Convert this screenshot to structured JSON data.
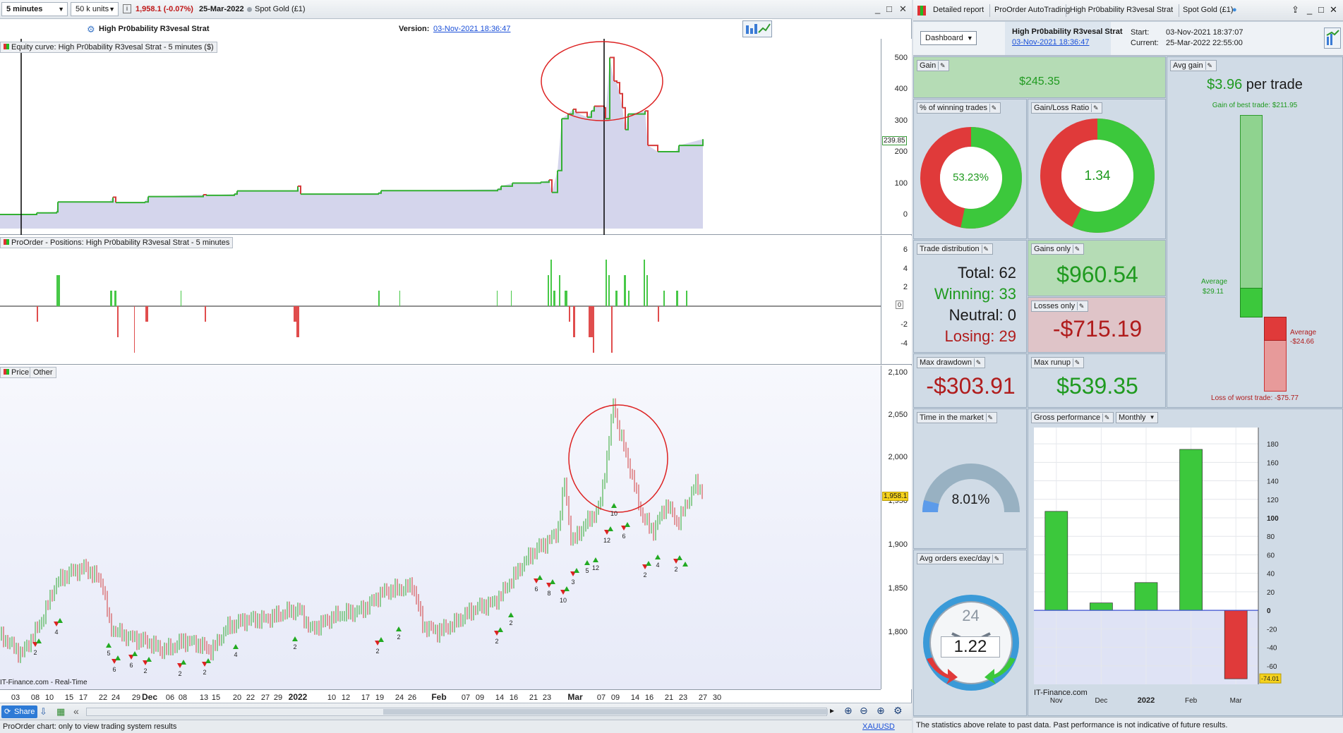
{
  "left": {
    "toolbar": {
      "timeframe": "5 minutes",
      "units": "50 k units",
      "price": "1,958.1 (-0.07%)",
      "date": "25-Mar-2022",
      "instrument": "Spot Gold (£1)"
    },
    "strategy_title": "High Pr0bability R3vesal Strat",
    "version_label": "Version:",
    "version_date": "03-Nov-2021 18:36:47",
    "panels": {
      "equity_label": "Equity curve: High Pr0bability R3vesal Strat - 5 minutes ($)",
      "positions_label": "ProOrder - Positions: High Pr0bability R3vesal Strat - 5 minutes",
      "price_label": "Price",
      "other_label": "Other"
    },
    "equity_axis": [
      "500",
      "400",
      "300",
      "200",
      "100",
      "0"
    ],
    "equity_last": "239.85",
    "positions_axis": [
      "6",
      "4",
      "2",
      "0",
      "-2",
      "-4"
    ],
    "positions_last": "0",
    "price_axis": [
      "2,100",
      "2,050",
      "2,000",
      "1,950",
      "1,900",
      "1,850",
      "1,800"
    ],
    "price_last": "1,958.1",
    "watermark": "IT-Finance.com - Real-Time",
    "date_axis": [
      "03",
      "08",
      "10",
      "15",
      "17",
      "22",
      "24",
      "29",
      "Dec",
      "06",
      "08",
      "13",
      "15",
      "20",
      "22",
      "27",
      "29",
      "2022",
      "10",
      "12",
      "17",
      "19",
      "24",
      "26",
      "Feb",
      "07",
      "09",
      "14",
      "16",
      "21",
      "23",
      "Mar",
      "07",
      "09",
      "14",
      "16",
      "21",
      "23",
      "27",
      "30"
    ],
    "trade_labels": [
      "2",
      "4",
      "5",
      "6",
      "6",
      "2",
      "2",
      "2",
      "4",
      "2",
      "2",
      "2",
      "2",
      "2",
      "6",
      "8",
      "10",
      "3",
      "5",
      "12",
      "12",
      "10",
      "6",
      "2",
      "4",
      "2"
    ],
    "share_label": "Share",
    "status_text": "ProOrder chart: only to view trading system results",
    "status_right": "XAUUSD"
  },
  "right": {
    "tabs": [
      "Detailed report",
      "ProOrder AutoTrading",
      "High Pr0bability R3vesal Strat",
      "Spot Gold (£1)"
    ],
    "dashboard_label": "Dashboard",
    "strategy_title": "High Pr0bability R3vesal Strat",
    "strategy_date": "03-Nov-2021 18:36:47",
    "start_label": "Start:",
    "start_value": "03-Nov-2021 18:37:07",
    "current_label": "Current:",
    "current_value": "25-Mar-2022 22:55:00",
    "gain": {
      "label": "Gain",
      "value": "$245.35"
    },
    "avg_gain": {
      "label": "Avg gain",
      "value": "$3.96",
      "suffix": "per trade",
      "best": "Gain of best trade: $211.95",
      "avg_pos_label": "Average",
      "avg_pos": "$29.11",
      "avg_neg_label": "Average",
      "avg_neg": "-$24.66",
      "worst": "Loss of worst trade: -$75.77"
    },
    "winning_pct": {
      "label": "% of winning trades",
      "value": "53.23%",
      "fraction": 0.5323
    },
    "gain_loss_ratio": {
      "label": "Gain/Loss Ratio",
      "value": "1.34",
      "fraction": 0.573
    },
    "trade_distribution": {
      "label": "Trade distribution",
      "total": "Total: 62",
      "winning": "Winning: 33",
      "neutral": "Neutral: 0",
      "losing": "Losing: 29"
    },
    "gains_only": {
      "label": "Gains only",
      "value": "$960.54"
    },
    "losses_only": {
      "label": "Losses only",
      "value": "-$715.19"
    },
    "max_drawdown": {
      "label": "Max drawdown",
      "value": "-$303.91"
    },
    "max_runup": {
      "label": "Max runup",
      "value": "$539.35"
    },
    "time_in_market": {
      "label": "Time in the market",
      "value": "8.01%",
      "fraction": 0.0801
    },
    "avg_orders": {
      "label": "Avg orders exec/day",
      "value": "1.22",
      "dial": "24"
    },
    "gross_perf": {
      "label": "Gross performance",
      "period": "Monthly"
    },
    "watermark": "IT-Finance.com",
    "footer": "The statistics above relate to past data. Past performance is not indicative of future results."
  },
  "chart_data": {
    "type": "bar",
    "categories": [
      "Nov",
      "Dec",
      "2022",
      "Feb",
      "Mar"
    ],
    "values": [
      107,
      8,
      30,
      174,
      -74.01
    ],
    "ylim": [
      -80,
      190
    ],
    "yticks": [
      "180",
      "160",
      "140",
      "120",
      "100",
      "80",
      "60",
      "40",
      "20",
      "0",
      "-20",
      "-40",
      "-60"
    ],
    "last_label": "-74.01",
    "colors": {
      "positive": "#3cc83c",
      "negative": "#e03a3a"
    }
  }
}
